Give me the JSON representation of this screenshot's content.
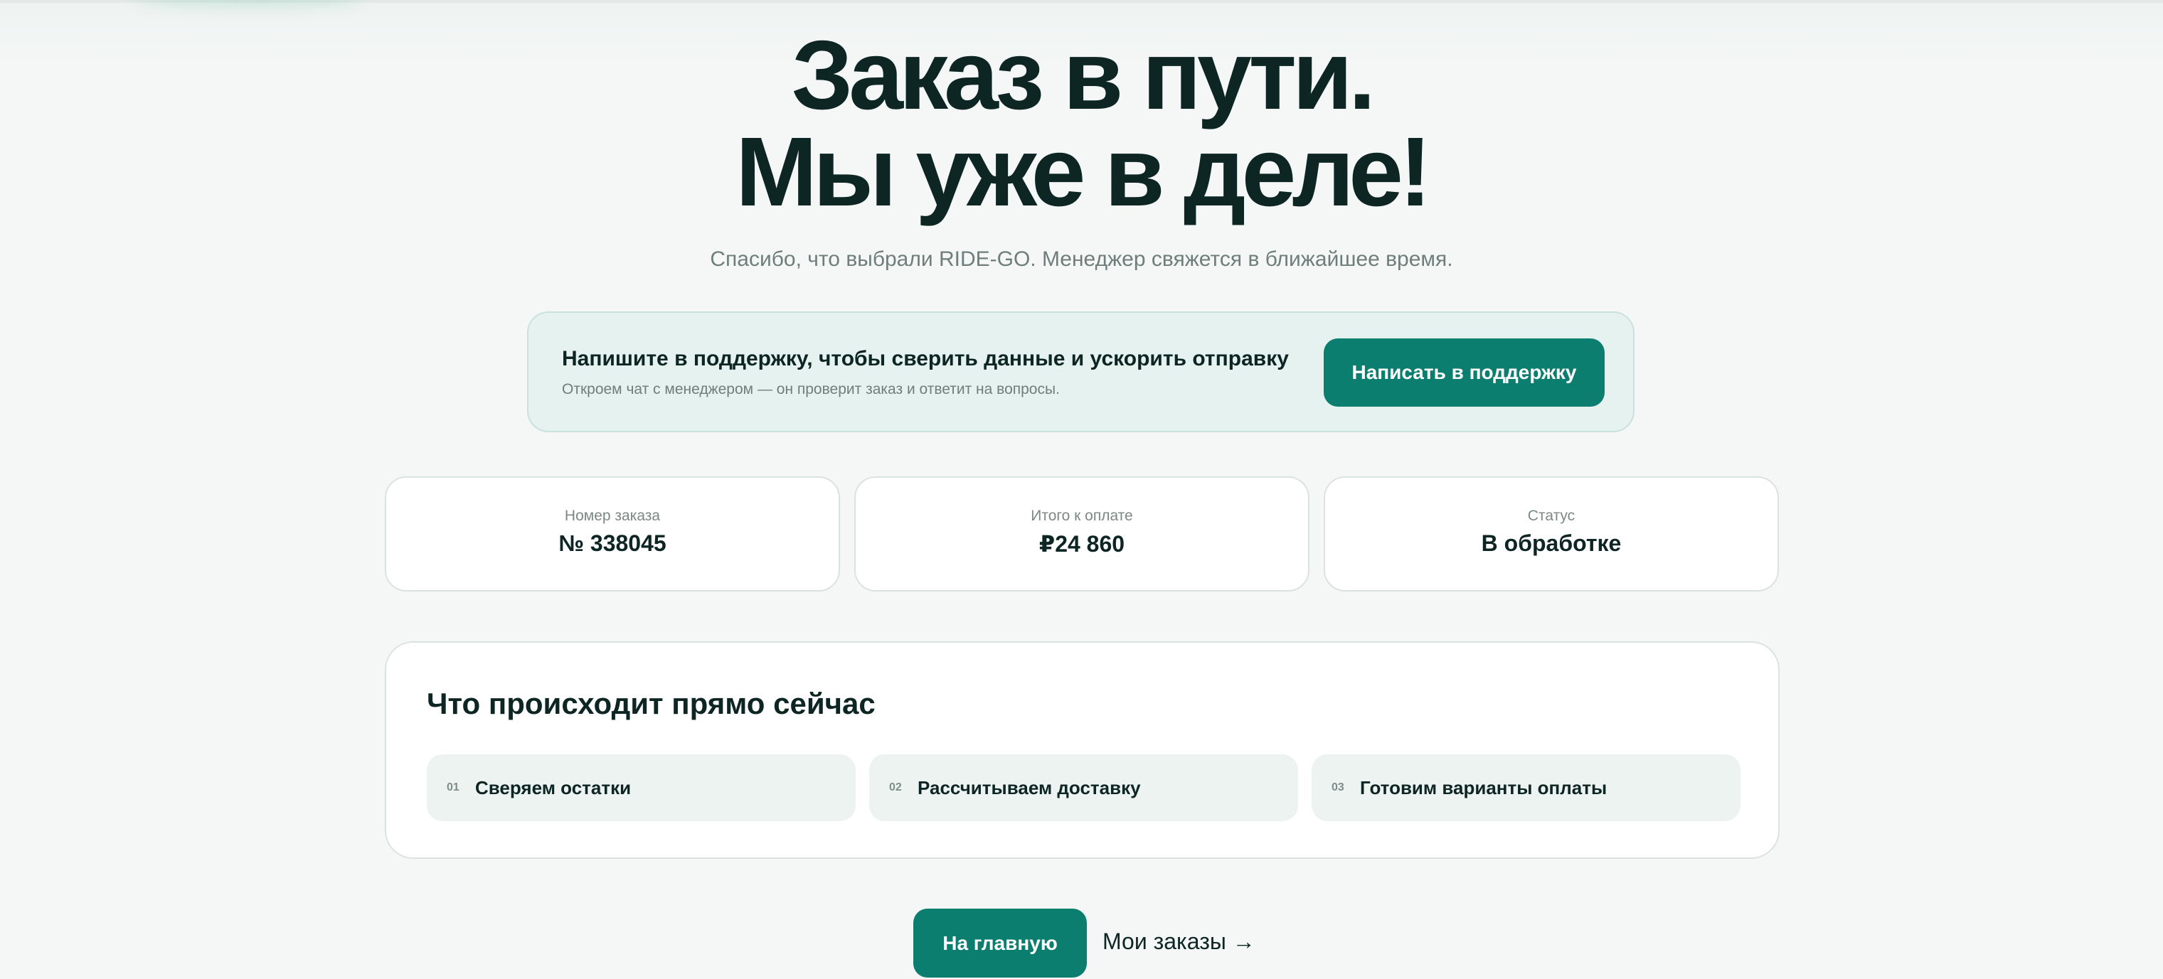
{
  "hero": {
    "title_line1": "Заказ в пути.",
    "title_line2": "Мы уже в деле!",
    "subtitle": "Спасибо, что выбрали RIDE-GO. Менеджер свяжется в ближайшее время."
  },
  "support": {
    "title": "Напишите в поддержку, чтобы сверить данные и ускорить отправку",
    "description": "Откроем чат с менеджером — он проверит заказ и ответит на вопросы.",
    "button_label": "Написать в поддержку"
  },
  "stats": [
    {
      "label": "Номер заказа",
      "value": "№ 338045"
    },
    {
      "label": "Итого к оплате",
      "value": "₽24 860"
    },
    {
      "label": "Статус",
      "value": "В обработке"
    }
  ],
  "now": {
    "title": "Что происходит прямо сейчас",
    "steps": [
      {
        "num": "01",
        "label": "Сверяем остатки"
      },
      {
        "num": "02",
        "label": "Рассчитываем доставку"
      },
      {
        "num": "03",
        "label": "Готовим варианты оплаты"
      }
    ]
  },
  "actions": {
    "home_label": "На главную",
    "orders_label": "Мои заказы →"
  },
  "colors": {
    "accent": "#0c7e70",
    "background": "#f4f7f6",
    "text": "#0d2523"
  }
}
